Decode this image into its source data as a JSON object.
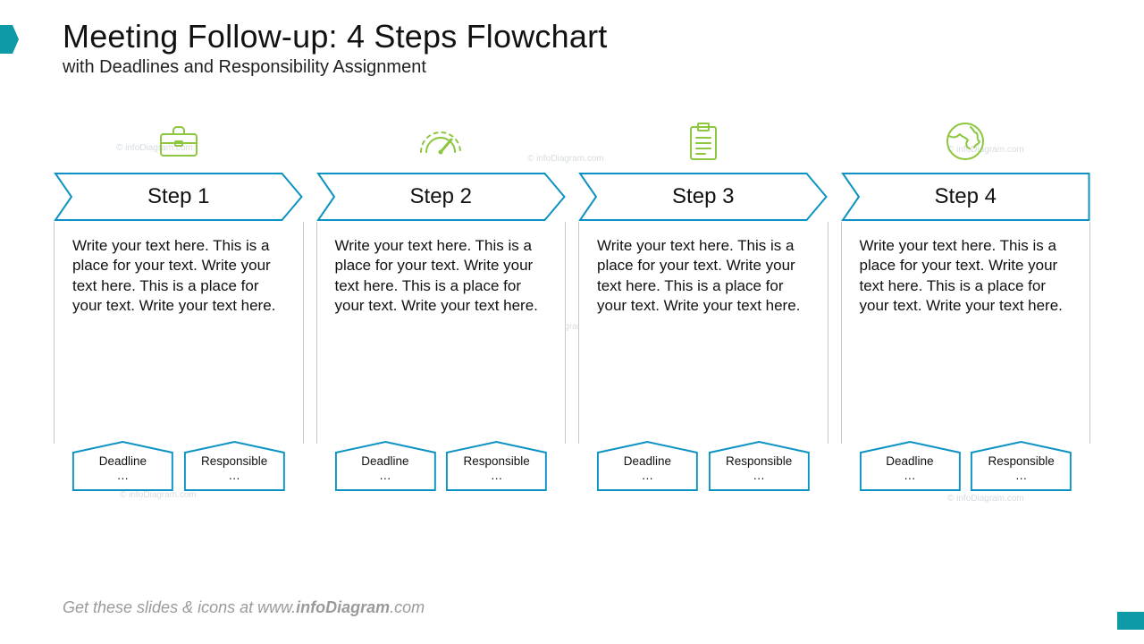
{
  "title": "Meeting Follow-up: 4 Steps Flowchart",
  "subtitle": "with Deadlines and Responsibility Assignment",
  "footer": {
    "prefix": "Get these slides & icons at www.",
    "brand": "infoDiagram",
    "suffix": ".com"
  },
  "colors": {
    "stroke": "#0c93c3",
    "icon": "#8dc63f"
  },
  "bodyPlaceholder": "Write your text here. This is a place for your text. Write your text here. This is a place for your text. Write your text here.",
  "tagPlaceholder": "…",
  "steps": [
    {
      "label": "Step 1",
      "icon": "briefcase-icon",
      "deadlineLabel": "Deadline",
      "responsibleLabel": "Responsible"
    },
    {
      "label": "Step 2",
      "icon": "gauge-icon",
      "deadlineLabel": "Deadline",
      "responsibleLabel": "Responsible"
    },
    {
      "label": "Step 3",
      "icon": "clipboard-icon",
      "deadlineLabel": "Deadline",
      "responsibleLabel": "Responsible"
    },
    {
      "label": "Step 4",
      "icon": "globe-icon",
      "deadlineLabel": "Deadline",
      "responsibleLabel": "Responsible"
    }
  ],
  "watermark": "© infoDiagram.com"
}
